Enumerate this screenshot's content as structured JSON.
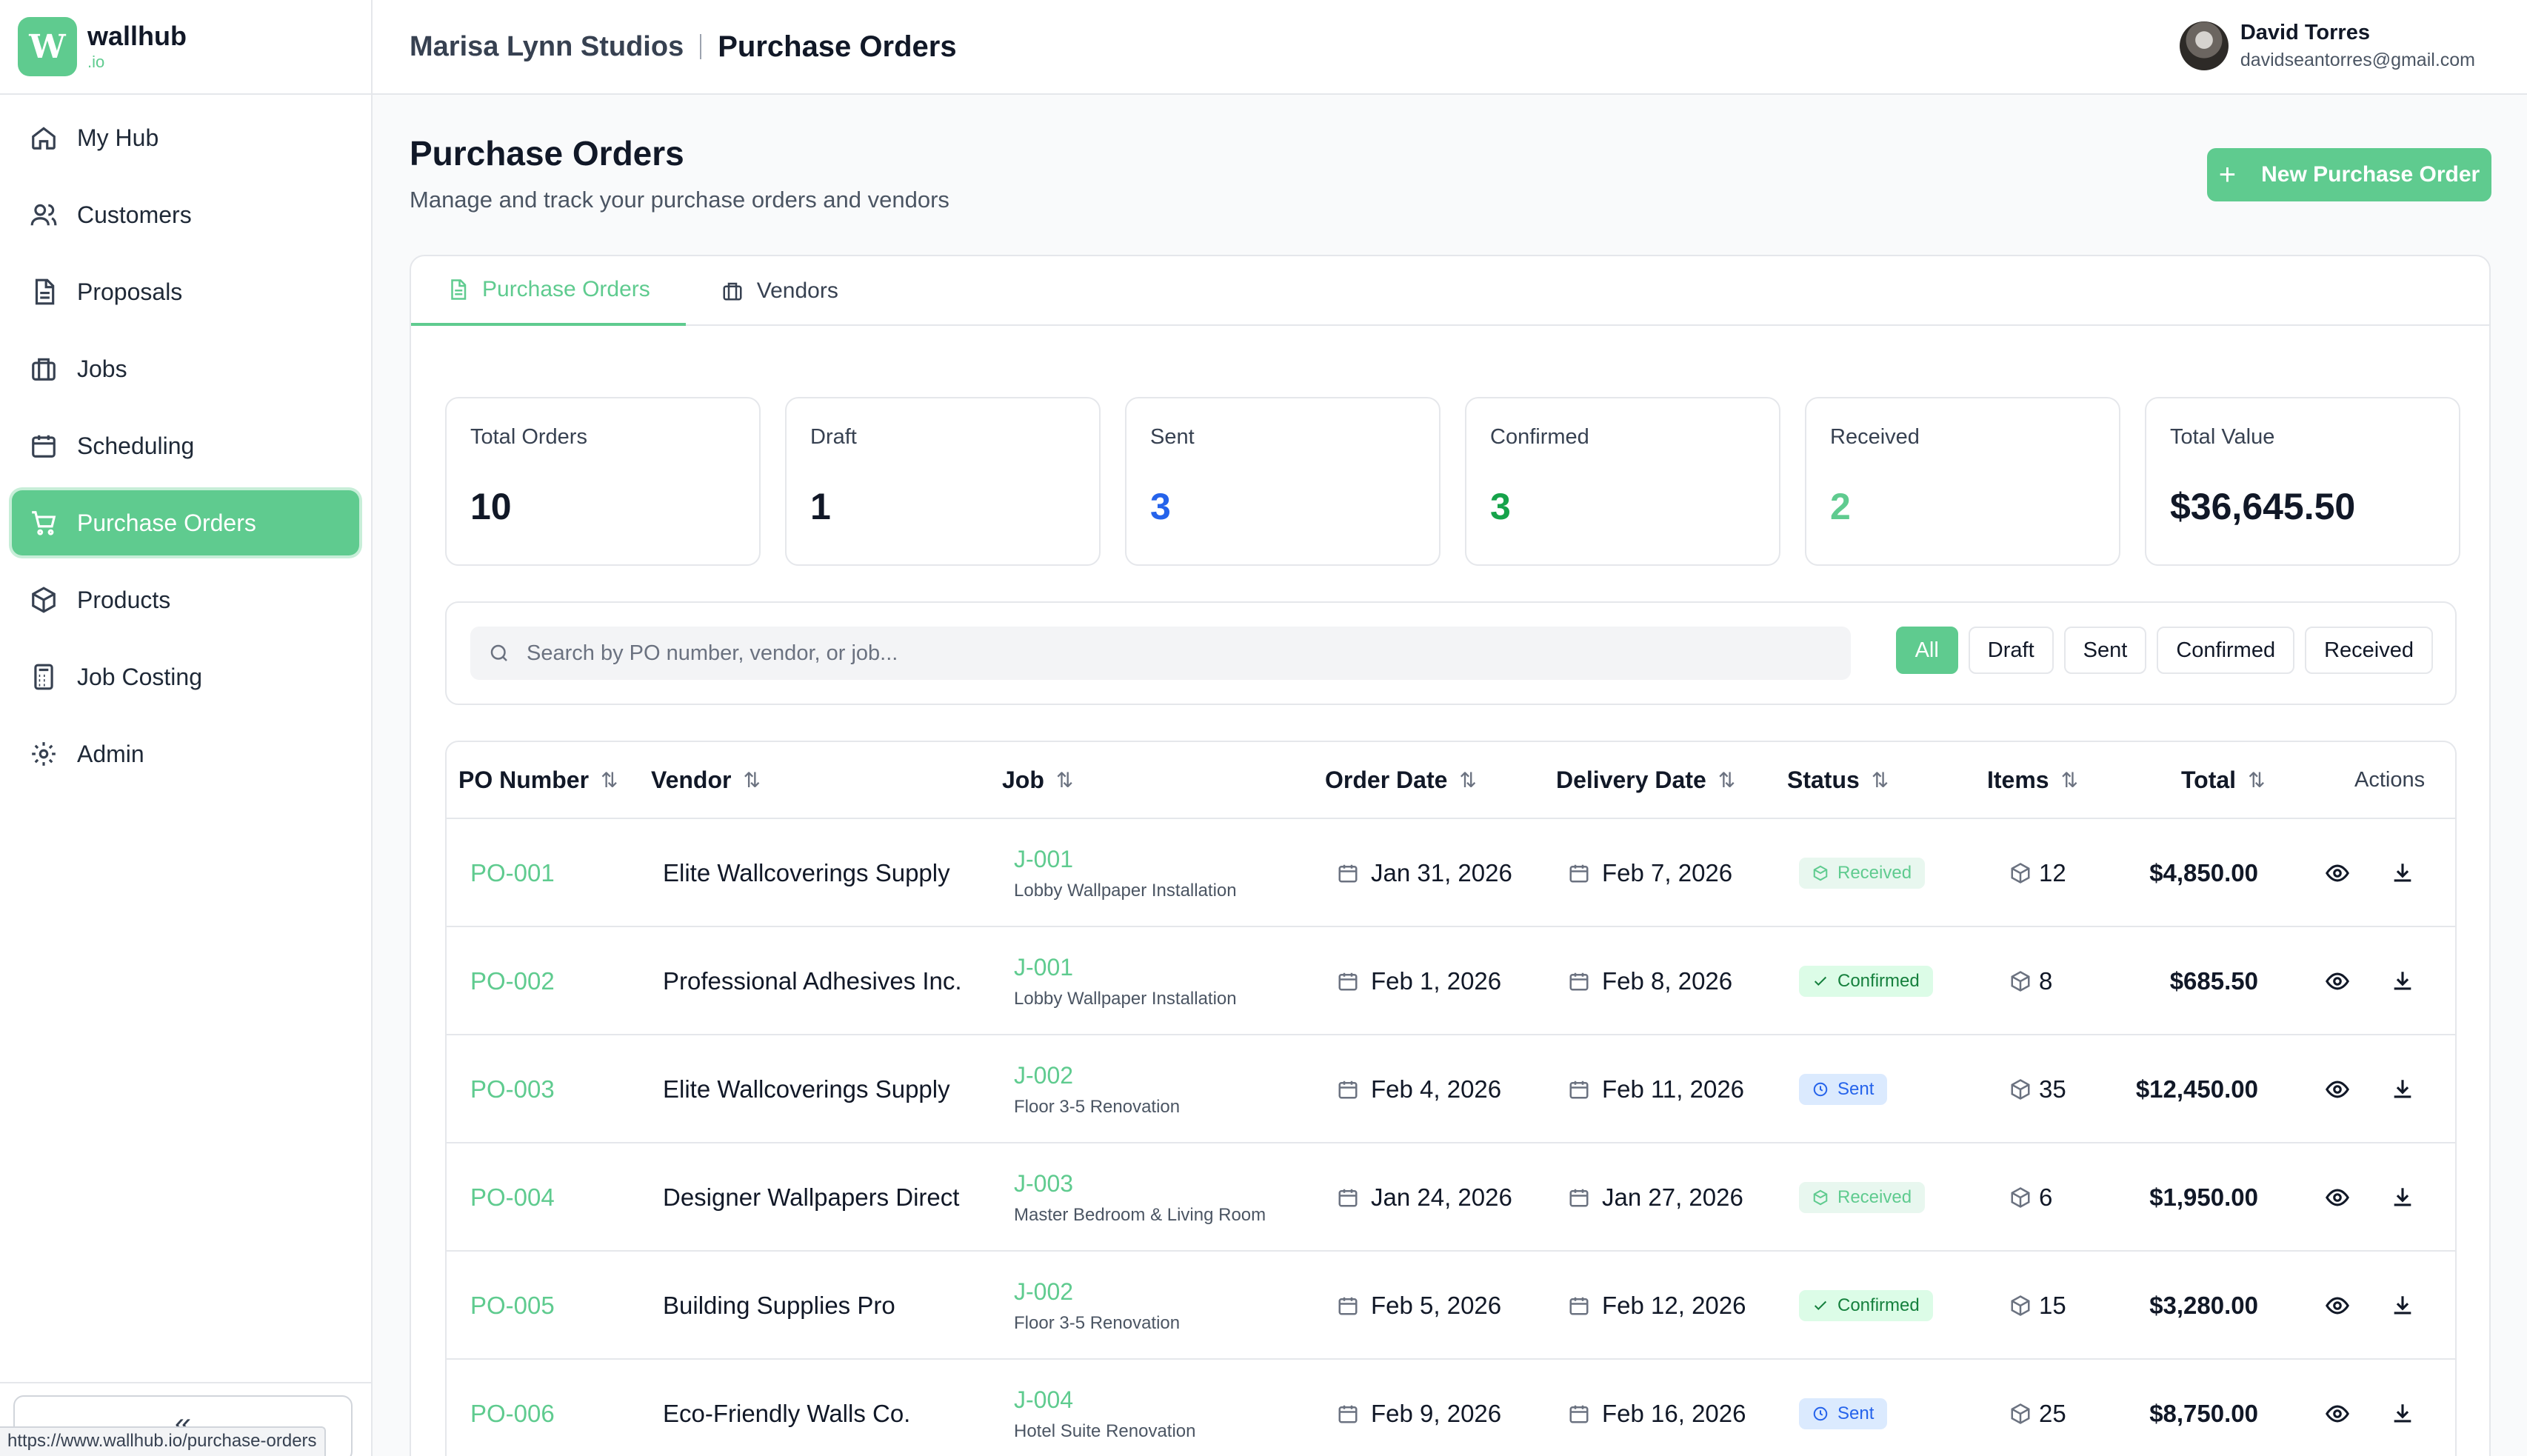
{
  "brand": {
    "logo_letter": "W",
    "name": "wallhub",
    "tld": ".io"
  },
  "nav": [
    {
      "label": "My Hub",
      "icon": "home-icon",
      "active": false
    },
    {
      "label": "Customers",
      "icon": "users-icon",
      "active": false
    },
    {
      "label": "Proposals",
      "icon": "document-icon",
      "active": false
    },
    {
      "label": "Jobs",
      "icon": "briefcase-icon",
      "active": false
    },
    {
      "label": "Scheduling",
      "icon": "calendar-icon",
      "active": false
    },
    {
      "label": "Purchase Orders",
      "icon": "cart-icon",
      "active": true
    },
    {
      "label": "Products",
      "icon": "box-icon",
      "active": false
    },
    {
      "label": "Job Costing",
      "icon": "calculator-icon",
      "active": false
    },
    {
      "label": "Admin",
      "icon": "gear-icon",
      "active": false
    }
  ],
  "sidebar_bottom": {
    "collapse_glyph": "«",
    "status_url": "https://www.wallhub.io/purchase-orders"
  },
  "header": {
    "company": "Marisa Lynn Studios",
    "page": "Purchase Orders"
  },
  "user": {
    "name": "David Torres",
    "email": "davidseantorres@gmail.com"
  },
  "page": {
    "title": "Purchase Orders",
    "subtitle": "Manage and track your purchase orders and vendors",
    "new_button": "New Purchase Order"
  },
  "tabs": [
    {
      "label": "Purchase Orders",
      "icon": "document-icon",
      "active": true
    },
    {
      "label": "Vendors",
      "icon": "building-icon",
      "active": false
    }
  ],
  "stats": [
    {
      "label": "Total Orders",
      "value": "10",
      "color": "#111827"
    },
    {
      "label": "Draft",
      "value": "1",
      "color": "#111827"
    },
    {
      "label": "Sent",
      "value": "3",
      "color": "#2563eb"
    },
    {
      "label": "Confirmed",
      "value": "3",
      "color": "#16a34a"
    },
    {
      "label": "Received",
      "value": "2",
      "color": "#5fcb8f"
    },
    {
      "label": "Total Value",
      "value": "$36,645.50",
      "color": "#111827"
    }
  ],
  "search": {
    "placeholder": "Search by PO number, vendor, or job...",
    "value": ""
  },
  "filters": [
    {
      "label": "All",
      "active": true
    },
    {
      "label": "Draft",
      "active": false
    },
    {
      "label": "Sent",
      "active": false
    },
    {
      "label": "Confirmed",
      "active": false
    },
    {
      "label": "Received",
      "active": false
    }
  ],
  "table": {
    "headers": {
      "po": "PO Number",
      "vendor": "Vendor",
      "job": "Job",
      "order_date": "Order Date",
      "delivery_date": "Delivery Date",
      "status": "Status",
      "items": "Items",
      "total": "Total",
      "actions": "Actions"
    },
    "sort_glyph": "⇅",
    "rows": [
      {
        "po": "PO-001",
        "vendor": "Elite Wallcoverings Supply",
        "job_id": "J-001",
        "job_name": "Lobby Wallpaper Installation",
        "order_date": "Jan 31, 2026",
        "delivery_date": "Feb 7, 2026",
        "status": "Received",
        "items": "12",
        "total": "$4,850.00"
      },
      {
        "po": "PO-002",
        "vendor": "Professional Adhesives Inc.",
        "job_id": "J-001",
        "job_name": "Lobby Wallpaper Installation",
        "order_date": "Feb 1, 2026",
        "delivery_date": "Feb 8, 2026",
        "status": "Confirmed",
        "items": "8",
        "total": "$685.50"
      },
      {
        "po": "PO-003",
        "vendor": "Elite Wallcoverings Supply",
        "job_id": "J-002",
        "job_name": "Floor 3-5 Renovation",
        "order_date": "Feb 4, 2026",
        "delivery_date": "Feb 11, 2026",
        "status": "Sent",
        "items": "35",
        "total": "$12,450.00"
      },
      {
        "po": "PO-004",
        "vendor": "Designer Wallpapers Direct",
        "job_id": "J-003",
        "job_name": "Master Bedroom & Living Room",
        "order_date": "Jan 24, 2026",
        "delivery_date": "Jan 27, 2026",
        "status": "Received",
        "items": "6",
        "total": "$1,950.00"
      },
      {
        "po": "PO-005",
        "vendor": "Building Supplies Pro",
        "job_id": "J-002",
        "job_name": "Floor 3-5 Renovation",
        "order_date": "Feb 5, 2026",
        "delivery_date": "Feb 12, 2026",
        "status": "Confirmed",
        "items": "15",
        "total": "$3,280.00"
      },
      {
        "po": "PO-006",
        "vendor": "Eco-Friendly Walls Co.",
        "job_id": "J-004",
        "job_name": "Hotel Suite Renovation",
        "order_date": "Feb 9, 2026",
        "delivery_date": "Feb 16, 2026",
        "status": "Sent",
        "items": "25",
        "total": "$8,750.00"
      }
    ]
  }
}
